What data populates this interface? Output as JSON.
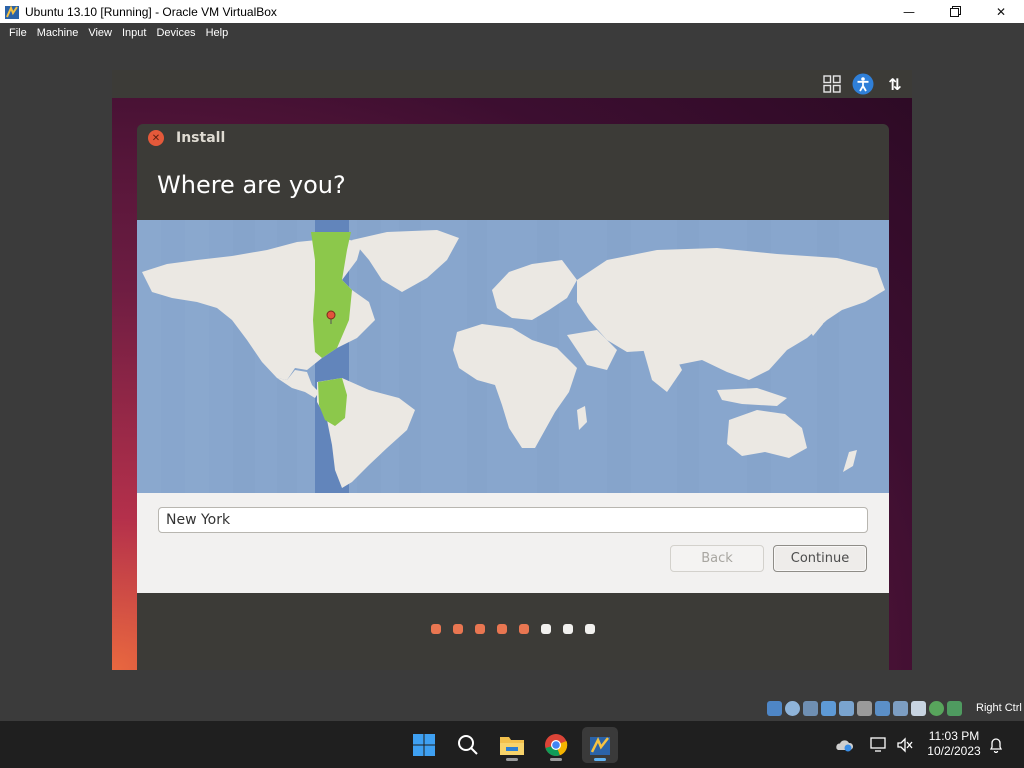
{
  "window": {
    "title": "Ubuntu 13.10 [Running] - Oracle VM VirtualBox",
    "minimize_icon": "minimize-icon",
    "maximize_icon": "maximize-icon",
    "close_icon": "close-icon"
  },
  "menu": {
    "items": [
      "File",
      "Machine",
      "View",
      "Input",
      "Devices",
      "Help"
    ]
  },
  "vm_panel": {
    "icons": [
      "grid-icon",
      "accessibility-icon",
      "network-arrows-icon"
    ]
  },
  "installer": {
    "dialog_title": "Install",
    "heading": "Where are you?",
    "timezone_value": "New York",
    "back_label": "Back",
    "continue_label": "Continue",
    "steps_done": 5,
    "steps_total": 8,
    "accent_color": "#e97651"
  },
  "statusbar": {
    "host_key": "Right Ctrl"
  },
  "taskbar": {
    "apps": [
      "windows-start-icon",
      "search-icon",
      "file-explorer-icon",
      "chrome-icon",
      "virtualbox-icon"
    ],
    "time": "11:03 PM",
    "date": "10/2/2023"
  }
}
